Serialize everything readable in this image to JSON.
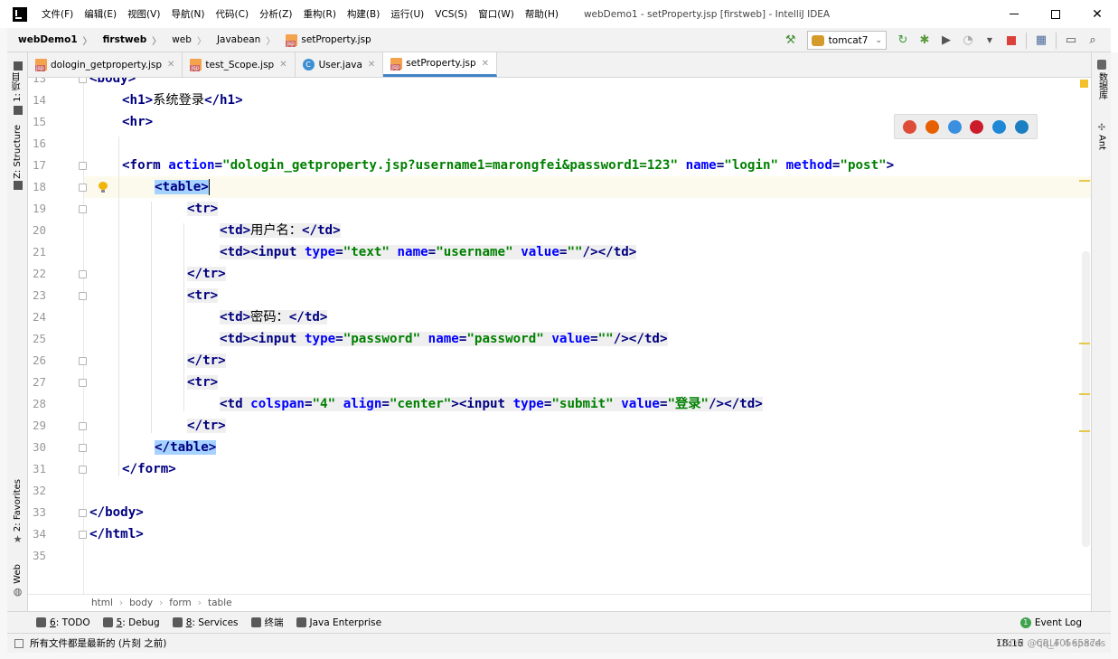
{
  "title_bar": {
    "menu": [
      "文件(F)",
      "编辑(E)",
      "视图(V)",
      "导航(N)",
      "代码(C)",
      "分析(Z)",
      "重构(R)",
      "构建(B)",
      "运行(U)",
      "VCS(S)",
      "窗口(W)",
      "帮助(H)"
    ],
    "window_title": "webDemo1 - setProperty.jsp [firstweb] - IntelliJ IDEA"
  },
  "navbar": {
    "breadcrumbs": [
      "webDemo1",
      "firstweb",
      "web",
      "Javabean",
      "setProperty.jsp"
    ],
    "run_config": "tomcat7"
  },
  "tabs": [
    {
      "label": "dologin_getproperty.jsp",
      "icon": "jsp-file-icon",
      "active": false
    },
    {
      "label": "test_Scope.jsp",
      "icon": "jsp-file-icon",
      "active": false
    },
    {
      "label": "User.java",
      "icon": "java-class-icon",
      "active": false
    },
    {
      "label": "setProperty.jsp",
      "icon": "jsp-file-icon",
      "active": true
    }
  ],
  "left_tools": [
    "1: 项目",
    "Z: Structure",
    "2: Favorites",
    "Web"
  ],
  "right_tools": [
    "数据库",
    "Ant"
  ],
  "editor": {
    "line_numbers": [
      "13",
      "14",
      "15",
      "16",
      "17",
      "18",
      "19",
      "20",
      "21",
      "22",
      "23",
      "24",
      "25",
      "26",
      "27",
      "28",
      "29",
      "30",
      "31",
      "32",
      "33",
      "34",
      "35"
    ],
    "current_line": "18",
    "lines": [
      {
        "segs": [
          [
            "t",
            "<"
          ],
          [
            "t",
            "body"
          ],
          [
            "t",
            ">"
          ]
        ]
      },
      {
        "segs": [
          [
            "t",
            "<h1>"
          ],
          [
            "p",
            "系统登录"
          ],
          [
            "t",
            "</h1>"
          ]
        ]
      },
      {
        "segs": [
          [
            "t",
            "<hr>"
          ]
        ]
      },
      {
        "segs": []
      },
      {
        "segs": [
          [
            "t",
            "<form "
          ],
          [
            "a",
            "action"
          ],
          [
            "t",
            "="
          ],
          [
            "v",
            "\"dologin_getproperty.jsp?username1=marongfei&password1=123\""
          ],
          [
            "p",
            " "
          ],
          [
            "a",
            "name"
          ],
          [
            "t",
            "="
          ],
          [
            "v",
            "\"login\""
          ],
          [
            "p",
            " "
          ],
          [
            "a",
            "method"
          ],
          [
            "t",
            "="
          ],
          [
            "v",
            "\"post\""
          ],
          [
            "t",
            ">"
          ]
        ]
      },
      {
        "segs": [
          [
            "t",
            "<table>"
          ]
        ]
      },
      {
        "segs": [
          [
            "t",
            "<tr>"
          ]
        ]
      },
      {
        "segs": [
          [
            "t",
            "<td>"
          ],
          [
            "p",
            "用户名："
          ],
          [
            "t",
            "</td>"
          ]
        ]
      },
      {
        "segs": [
          [
            "t",
            "<td><"
          ],
          [
            "t",
            "input"
          ],
          [
            "p",
            " "
          ],
          [
            "a",
            "type"
          ],
          [
            "t",
            "="
          ],
          [
            "v",
            "\"text\""
          ],
          [
            "p",
            " "
          ],
          [
            "a",
            "name"
          ],
          [
            "t",
            "="
          ],
          [
            "v",
            "\"username\""
          ],
          [
            "p",
            " "
          ],
          [
            "a",
            "value"
          ],
          [
            "t",
            "="
          ],
          [
            "v",
            "\"\""
          ],
          [
            "t",
            "/></td>"
          ]
        ]
      },
      {
        "segs": [
          [
            "t",
            "</tr>"
          ]
        ]
      },
      {
        "segs": [
          [
            "t",
            "<tr>"
          ]
        ]
      },
      {
        "segs": [
          [
            "t",
            "<td>"
          ],
          [
            "p",
            "密码："
          ],
          [
            "t",
            "</td>"
          ]
        ]
      },
      {
        "segs": [
          [
            "t",
            "<td><"
          ],
          [
            "t",
            "input"
          ],
          [
            "p",
            " "
          ],
          [
            "a",
            "type"
          ],
          [
            "t",
            "="
          ],
          [
            "v",
            "\"password\""
          ],
          [
            "p",
            " "
          ],
          [
            "a",
            "name"
          ],
          [
            "t",
            "="
          ],
          [
            "v",
            "\"password\""
          ],
          [
            "p",
            " "
          ],
          [
            "a",
            "value"
          ],
          [
            "t",
            "="
          ],
          [
            "v",
            "\"\""
          ],
          [
            "t",
            "/></td>"
          ]
        ]
      },
      {
        "segs": [
          [
            "t",
            "</tr>"
          ]
        ]
      },
      {
        "segs": [
          [
            "t",
            "<tr>"
          ]
        ]
      },
      {
        "segs": [
          [
            "t",
            "<td "
          ],
          [
            "a",
            "colspan"
          ],
          [
            "t",
            "="
          ],
          [
            "v",
            "\"4\""
          ],
          [
            "p",
            " "
          ],
          [
            "a",
            "align"
          ],
          [
            "t",
            "="
          ],
          [
            "v",
            "\"center\""
          ],
          [
            "t",
            "><input "
          ],
          [
            "a",
            "type"
          ],
          [
            "t",
            "="
          ],
          [
            "v",
            "\"submit\""
          ],
          [
            "p",
            " "
          ],
          [
            "a",
            "value"
          ],
          [
            "t",
            "="
          ],
          [
            "v",
            "\"登录\""
          ],
          [
            "t",
            "/></td>"
          ]
        ]
      },
      {
        "segs": [
          [
            "t",
            "</tr>"
          ]
        ]
      },
      {
        "segs": [
          [
            "t",
            "</table>"
          ]
        ]
      },
      {
        "segs": [
          [
            "t",
            "</form>"
          ]
        ]
      },
      {
        "segs": []
      },
      {
        "segs": [
          [
            "t",
            "</body>"
          ]
        ]
      },
      {
        "segs": [
          [
            "t",
            "</html>"
          ]
        ]
      },
      {
        "segs": []
      }
    ]
  },
  "browser_popup": [
    "chrome-icon",
    "firefox-icon",
    "safari-icon",
    "opera-icon",
    "ie-icon",
    "edge-icon"
  ],
  "editor_breadcrumb": [
    "html",
    "body",
    "form",
    "table"
  ],
  "bottom_tools": [
    {
      "key": "6",
      "label": ": TODO",
      "icon": "todo-icon"
    },
    {
      "key": "5",
      "label": ": Debug",
      "icon": "debug-icon"
    },
    {
      "key": "8",
      "label": ": Services",
      "icon": "services-icon"
    },
    {
      "key": "",
      "label": "终端",
      "icon": "terminal-icon"
    },
    {
      "key": "",
      "label": "Java Enterprise",
      "icon": "java-enterprise-icon"
    }
  ],
  "event_log": "Event Log",
  "status": {
    "message": "所有文件都是最新的 (片刻 之前)",
    "position": "18:16",
    "line_sep": "CRLF",
    "indent": "4 spaces",
    "watermark": "CSDN @qq_40565874"
  },
  "colors": {
    "tag": "#000080",
    "attr": "#0000ff",
    "string": "#008000",
    "selection": "#a6d2ff",
    "current_line": "#fcfaed"
  }
}
